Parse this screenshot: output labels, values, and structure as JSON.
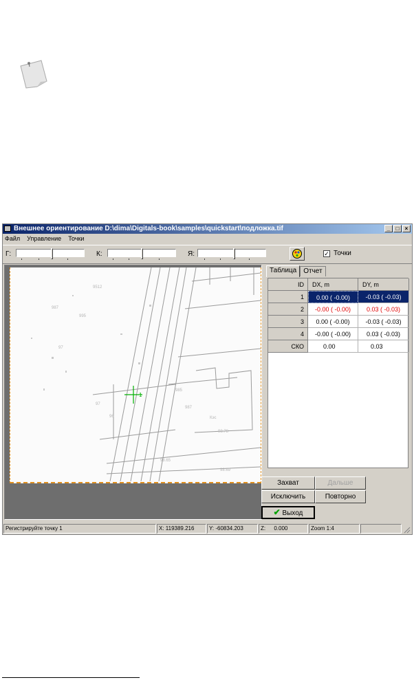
{
  "window": {
    "title": "Внешнее ориентирование D:\\dima\\Digitals-book\\samples\\quickstart\\подложка.tif",
    "controls": {
      "minimize": "_",
      "maximize": "□",
      "close": "×"
    }
  },
  "menu": [
    "Файл",
    "Управление",
    "Точки"
  ],
  "toolbar": {
    "labels": [
      "Г:",
      "К:",
      "Я:"
    ],
    "points_checkbox": {
      "label": "Точки",
      "checked": true
    }
  },
  "tabs": [
    {
      "label": "Таблица",
      "active": true
    },
    {
      "label": "Отчет",
      "active": false
    }
  ],
  "table": {
    "headers": [
      "ID",
      "DX, m",
      "DY, m"
    ],
    "rows": [
      {
        "id": "1",
        "dx": "0.00 ( -0.00)",
        "dy": "-0.03 ( -0.03)",
        "selected": true
      },
      {
        "id": "2",
        "dx": "-0.00 ( -0.00)",
        "dy": "0.03 ( -0.03)",
        "color": "#e00000"
      },
      {
        "id": "3",
        "dx": "0.00 ( -0.00)",
        "dy": "-0.03 ( -0.03)"
      },
      {
        "id": "4",
        "dx": "-0.00 ( -0.00)",
        "dy": "0.03 ( -0.03)"
      },
      {
        "id": "СКО",
        "dx": "0.00",
        "dy": "0.03"
      }
    ]
  },
  "buttons": {
    "capture": "Захват",
    "next": "Дальше",
    "exclude": "Исключить",
    "repeat": "Повторно",
    "exit": "Выход"
  },
  "map": {
    "point_label": "1"
  },
  "status": {
    "message": "Регистрируйте точку 1",
    "x": "X: 119389.216",
    "y": "Y: -60834.203",
    "z_label": "Z:",
    "z": "0.000",
    "zoom": "Zoom 1:4"
  },
  "icons": {
    "note": "sticky-note-icon",
    "app": "window-app-icon",
    "mode": "smiley-icon",
    "exit": "checkmark-icon",
    "crosshair": "crosshair-icon"
  },
  "colors": {
    "titlebar": "#0a246a",
    "selection": "#0a246a",
    "error_text": "#e00000",
    "crosshair": "#00b000",
    "frame": "#e0901f"
  }
}
